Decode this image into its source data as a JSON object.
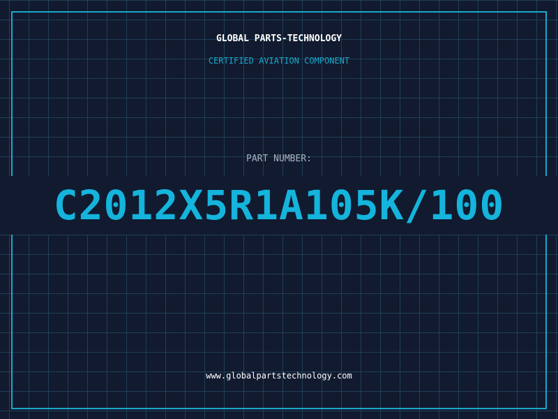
{
  "header": {
    "company": "GLOBAL PARTS-TECHNOLOGY",
    "tagline": "CERTIFIED AVIATION COMPONENT"
  },
  "part": {
    "label": "PART NUMBER:",
    "number": "C2012X5R1A105K/100"
  },
  "footer": {
    "website": "www.globalpartstechnology.com"
  },
  "colors": {
    "background": "#111a2e",
    "grid": "#1f4058",
    "accent": "#1aa8cc",
    "part_number": "#14b4dc"
  }
}
